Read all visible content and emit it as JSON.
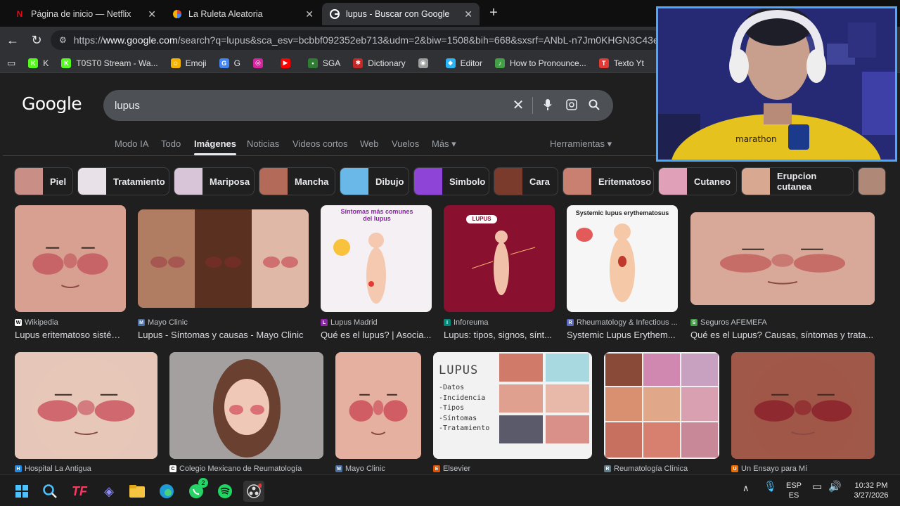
{
  "tabs": [
    {
      "title": "Página de inicio — Netflix",
      "icon": "netflix-icon",
      "color": "#e50914"
    },
    {
      "title": "La Ruleta Aleatoria",
      "icon": "roulette-icon",
      "color": "#8bc34a"
    },
    {
      "title": "lupus - Buscar con Google",
      "icon": "google-icon",
      "color": "#4285f4"
    }
  ],
  "address": {
    "prefix": "https://",
    "host": "www.google.com",
    "rest": "/search?q=lupus&sca_esv=bcbbf092352eb713&udm=2&biw=1508&bih=668&sxsrf=ANbL-n7Jm0KHGN3C43ejB-VRu..."
  },
  "bookmarks": [
    {
      "label": "K",
      "color": "#53fc18",
      "glyph": "K"
    },
    {
      "label": "T0ST0 Stream - Wa...",
      "color": "#53fc18",
      "glyph": "K"
    },
    {
      "label": "Emoji",
      "color": "#f5b400",
      "glyph": "☺"
    },
    {
      "label": "G",
      "color": "#4285f4",
      "glyph": "G"
    },
    {
      "label": "",
      "color": "#d6249f",
      "glyph": "◎"
    },
    {
      "label": "",
      "color": "#ff0000",
      "glyph": "▶"
    },
    {
      "label": "SGA",
      "color": "#2e7d32",
      "glyph": "•"
    },
    {
      "label": "Dictionary",
      "color": "#c62828",
      "glyph": "✱"
    },
    {
      "label": "",
      "color": "#9e9e9e",
      "glyph": "◉"
    },
    {
      "label": "Editor",
      "color": "#29b6f6",
      "glyph": "◆"
    },
    {
      "label": "How to Pronounce...",
      "color": "#43a047",
      "glyph": "♪"
    },
    {
      "label": "Texto Yt",
      "color": "#e53935",
      "glyph": "T"
    }
  ],
  "search": {
    "logo": "Google",
    "query": "lupus"
  },
  "nav_tabs": [
    "Modo IA",
    "Todo",
    "Imágenes",
    "Noticias",
    "Videos cortos",
    "Web",
    "Vuelos",
    "Más ▾",
    "Herramientas ▾"
  ],
  "chips": [
    {
      "label": "Piel",
      "color": "#c98f86"
    },
    {
      "label": "Tratamiento",
      "color": "#e8e1e8"
    },
    {
      "label": "Mariposa",
      "color": "#d8c6d8"
    },
    {
      "label": "Mancha",
      "color": "#b46a58"
    },
    {
      "label": "Dibujo",
      "color": "#69b8e8"
    },
    {
      "label": "Simbolo",
      "color": "#8e44d6"
    },
    {
      "label": "Cara",
      "color": "#7a3a2c"
    },
    {
      "label": "Eritematoso",
      "color": "#c98070"
    },
    {
      "label": "Cutaneo",
      "color": "#e0a0b8"
    },
    {
      "label": "Erupcion cutanea",
      "color": "#d8a890"
    }
  ],
  "results_row1": [
    {
      "source": "Wikipedia",
      "title": "Lupus eritematoso sistém...",
      "src_color": "#ffffff",
      "glyph": "W",
      "bg": "#a8675a"
    },
    {
      "source": "Mayo Clinic",
      "title": "Lupus - Síntomas y causas - Mayo Clinic",
      "src_color": "#4a6fa5",
      "glyph": "M",
      "bg": "#8a5a48"
    },
    {
      "source": "Lupus Madrid",
      "title": "Qué es el lupus? | Asocia...",
      "src_color": "#8e24aa",
      "glyph": "L",
      "bg": "#f4f0f4"
    },
    {
      "source": "Inforeuma",
      "title": "Lupus: tipos, signos, sínt...",
      "src_color": "#00897b",
      "glyph": "I",
      "bg": "#8a1030"
    },
    {
      "source": "Rheumatology & Infectious ...",
      "title": "Systemic Lupus Erythem...",
      "src_color": "#5c6bc0",
      "glyph": "R",
      "bg": "#f6f6f6"
    },
    {
      "source": "Seguros AFEMEFA",
      "title": "Qué es el Lupus? Causas, síntomas y trata...",
      "src_color": "#43a047",
      "glyph": "S",
      "bg": "#c07868"
    }
  ],
  "results_row2": [
    {
      "source": "Hospital La Antigua",
      "src_color": "#1e88e5",
      "glyph": "H",
      "bg": "#d8b8ac"
    },
    {
      "source": "Colegio Mexicano de Reumatología",
      "src_color": "#ffffff",
      "glyph": "C",
      "bg": "#9a7060"
    },
    {
      "source": "Mayo Clinic",
      "src_color": "#4a6fa5",
      "glyph": "M",
      "bg": "#d49a8a"
    },
    {
      "source": "Elsevier",
      "src_color": "#e65100",
      "glyph": "E",
      "bg": "#f2f2f2"
    },
    {
      "source": "Reumatología Clínica",
      "src_color": "#607d8b",
      "glyph": "R",
      "bg": "#c8806c"
    },
    {
      "source": "Un Ensayo para Mí",
      "src_color": "#ef6c00",
      "glyph": "U",
      "bg": "#b0604c"
    }
  ],
  "infographics": {
    "lupus_madrid_title": "Síntomas más comunes del lupus",
    "inforeuma_title": "LUPUS",
    "rheum_title": "Systemic lupus erythematosus",
    "elsevier_title": "LUPUS",
    "elsevier_items": [
      "-Datos",
      "-Incidencia",
      "-Tipos",
      "-Síntomas",
      "-Tratamiento"
    ]
  },
  "tray": {
    "lang1": "ESP",
    "lang2": "ES",
    "time": "10:32 PM",
    "date": "3/27/2026"
  },
  "taskbar_badge": "2"
}
